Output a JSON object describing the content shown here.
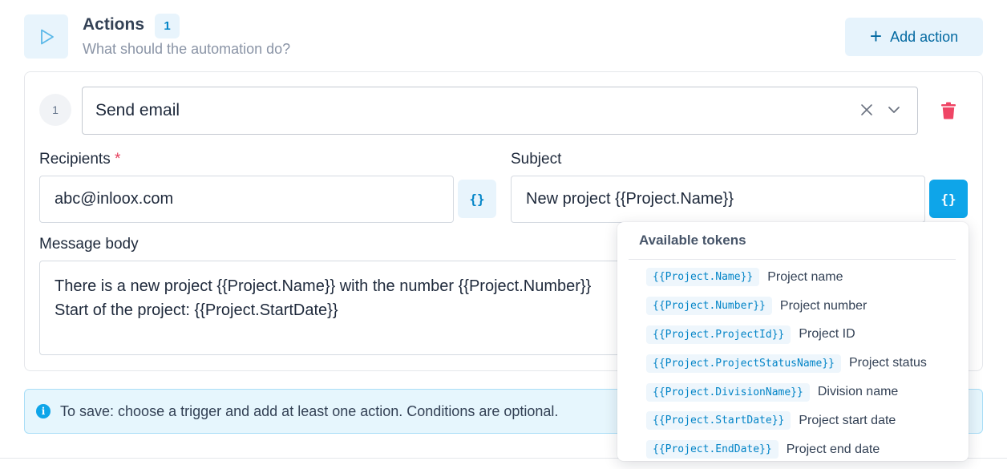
{
  "header": {
    "title": "Actions",
    "count": "1",
    "subtitle": "What should the automation do?",
    "add_action_label": "Add action"
  },
  "action": {
    "step_number": "1",
    "selected_type": "Send email",
    "recipients_label": "Recipients",
    "required_marker": "*",
    "recipients_value": "abc@inloox.com",
    "subject_label": "Subject",
    "subject_value": "New project {{Project.Name}}",
    "message_label": "Message body",
    "message_lines": [
      "There is a new project {{Project.Name}} with the number {{Project.Number}}",
      "Start of the project: {{Project.StartDate}}"
    ],
    "token_button_label": "{}"
  },
  "info": {
    "text": "To save: choose a trigger and add at least one action. Conditions are optional."
  },
  "tokens_popup": {
    "title": "Available tokens",
    "items": [
      {
        "token": "{{Project.Name}}",
        "description": "Project name"
      },
      {
        "token": "{{Project.Number}}",
        "description": "Project number"
      },
      {
        "token": "{{Project.ProjectId}}",
        "description": "Project ID"
      },
      {
        "token": "{{Project.ProjectStatusName}}",
        "description": "Project status"
      },
      {
        "token": "{{Project.DivisionName}}",
        "description": "Division name"
      },
      {
        "token": "{{Project.StartDate}}",
        "description": "Project start date"
      },
      {
        "token": "{{Project.EndDate}}",
        "description": "Project end date"
      }
    ]
  },
  "icons": {
    "header": "play-icon",
    "add": "plus-icon",
    "clear": "close-icon",
    "dropdown": "chevron-down-icon",
    "delete": "trash-icon",
    "info": "info-icon"
  },
  "colors": {
    "accent": "#0ea5e9",
    "accent_dark": "#0284c7",
    "danger": "#e53e5c",
    "info_bg": "#e6f6fd"
  }
}
